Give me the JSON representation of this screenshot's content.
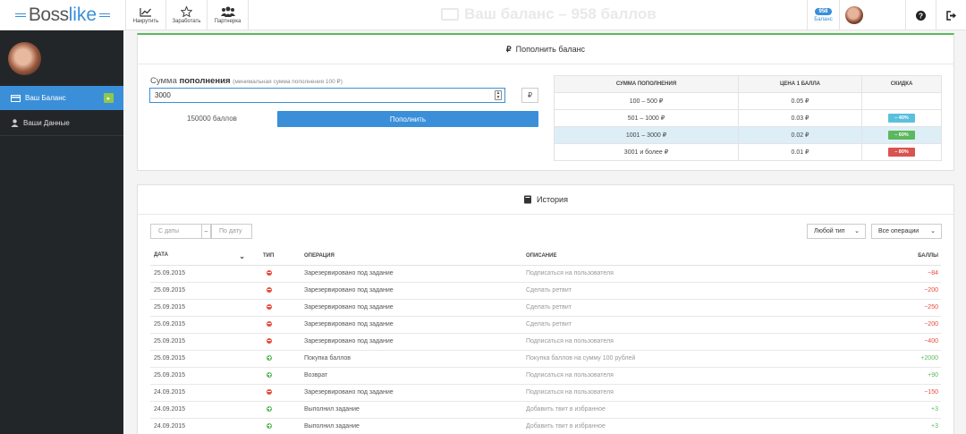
{
  "header": {
    "logo_part1": "Boss",
    "logo_part2": "like",
    "nav": [
      {
        "label": "Накрутить",
        "icon": "chart-line-icon"
      },
      {
        "label": "Заработать",
        "icon": "star-icon"
      },
      {
        "label": "Партнерка",
        "icon": "users-icon"
      }
    ],
    "ghost_title": "Ваш баланс – 958 баллов",
    "balance_count": "958",
    "balance_label": "Баланс"
  },
  "sidebar": {
    "items": [
      {
        "label": "Ваш Баланс",
        "icon": "wallet-icon",
        "active": true
      },
      {
        "label": "Ваши Данные",
        "icon": "user-icon",
        "active": false
      }
    ]
  },
  "topup": {
    "title": "Пополнить баланс",
    "amount_label_1": "Сумма ",
    "amount_label_2": "пополнения",
    "amount_hint": "(минимальная сумма пополнения 100 ₽)",
    "amount_value": "3000",
    "currency": "₽",
    "points": "150000 баллов",
    "button": "Пополнить",
    "price_headers": [
      "СУММА ПОПОЛНЕНИЯ",
      "ЦЕНА 1 БАЛЛА",
      "СКИДКА"
    ],
    "price_rows": [
      {
        "range": "100 – 500 ₽",
        "price": "0.05 ₽",
        "discount": ""
      },
      {
        "range": "501 – 1000 ₽",
        "price": "0.03 ₽",
        "discount": "– 40%",
        "color": "#5bc0de"
      },
      {
        "range": "1001 – 3000 ₽",
        "price": "0.02 ₽",
        "discount": "– 60%",
        "color": "#5cb85c"
      },
      {
        "range": "3001 и более ₽",
        "price": "0.01 ₽",
        "discount": "– 80%",
        "color": "#d9534f"
      }
    ]
  },
  "history": {
    "title": "История",
    "from_placeholder": "С даты",
    "sep": "–",
    "to_placeholder": "По дату",
    "type_filter": "Любой тип",
    "ops_filter": "Все операции",
    "headers": [
      "ДАТА",
      "ТИП",
      "ОПЕРАЦИЯ",
      "ОПИСАНИЕ",
      "БАЛЛЫ"
    ],
    "rows": [
      {
        "date": "25.09.2015",
        "type": "minus",
        "op": "Зарезервировано под задание",
        "desc": "Подписаться на пользователя",
        "pts": "−84"
      },
      {
        "date": "25.09.2015",
        "type": "minus",
        "op": "Зарезервировано под задание",
        "desc": "Сделать ретвит",
        "pts": "−200"
      },
      {
        "date": "25.09.2015",
        "type": "minus",
        "op": "Зарезервировано под задание",
        "desc": "Сделать ретвит",
        "pts": "−250"
      },
      {
        "date": "25.09.2015",
        "type": "minus",
        "op": "Зарезервировано под задание",
        "desc": "Сделать ретвит",
        "pts": "−200"
      },
      {
        "date": "25.09.2015",
        "type": "minus",
        "op": "Зарезервировано под задание",
        "desc": "Подписаться на пользователя",
        "pts": "−400"
      },
      {
        "date": "25.09.2015",
        "type": "plus",
        "op": "Покупка баллов",
        "desc": "Покупка баллов на сумму 100 рублей",
        "pts": "+2000"
      },
      {
        "date": "25.09.2015",
        "type": "plus",
        "op": "Возврат",
        "desc": "Подписаться на пользователя",
        "pts": "+90"
      },
      {
        "date": "24.09.2015",
        "type": "minus",
        "op": "Зарезервировано под задание",
        "desc": "Подписаться на пользователя",
        "pts": "−150"
      },
      {
        "date": "24.09.2015",
        "type": "plus",
        "op": "Выполнил задание",
        "desc": "Добавить твит в избранное",
        "pts": "+3"
      },
      {
        "date": "24.09.2015",
        "type": "plus",
        "op": "Выполнил задание",
        "desc": "Добавить твит в избранное",
        "pts": "+3"
      }
    ]
  },
  "colors": {
    "accent": "#3a8fd8",
    "minus": "#e74c3c",
    "plus": "#5cb85c"
  }
}
